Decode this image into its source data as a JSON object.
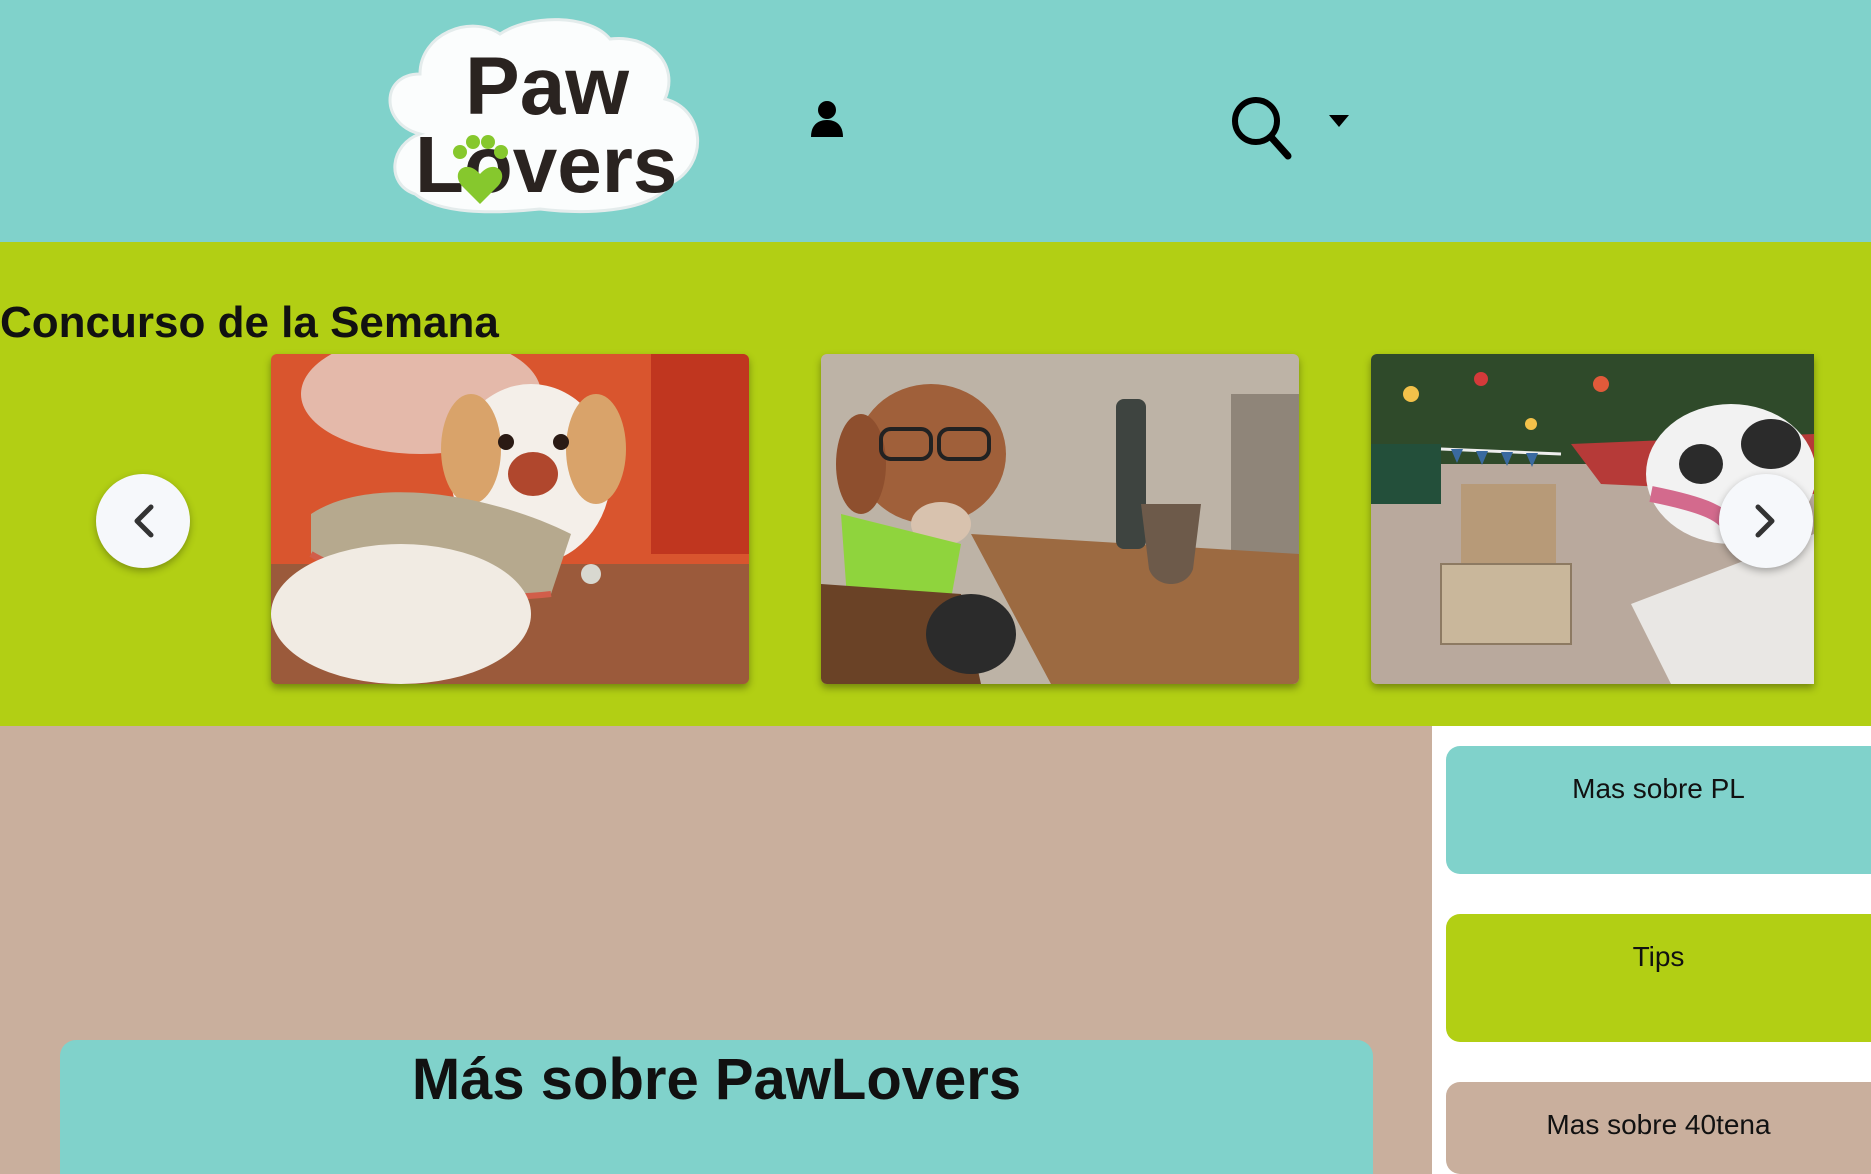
{
  "header": {
    "logo_line1": "Paw",
    "logo_line2": "Lovers",
    "icons": [
      "user-icon",
      "search-icon",
      "caret-down-icon"
    ]
  },
  "carousel": {
    "title": "Concurso de la Semana",
    "slides": [
      "dog-in-knit-sweater-photo",
      "dog-with-glasses-and-mate-photo",
      "dog-with-christmas-gift-photo"
    ],
    "prev_icon": "chevron-left-icon",
    "next_icon": "chevron-right-icon"
  },
  "sidebar": {
    "items": [
      {
        "label": "Mas sobre PL",
        "color": "#80d2cb"
      },
      {
        "label": "Tips",
        "color": "#b2cf14"
      },
      {
        "label": "Mas sobre 40tena",
        "color": "#c9af9d"
      }
    ]
  },
  "main": {
    "section_title": "Más sobre PawLovers"
  },
  "colors": {
    "header_bg": "#80d2cb",
    "banner_bg": "#b2cf14",
    "page_bg": "#c9af9d",
    "sidebar_bg": "#ffffff"
  }
}
